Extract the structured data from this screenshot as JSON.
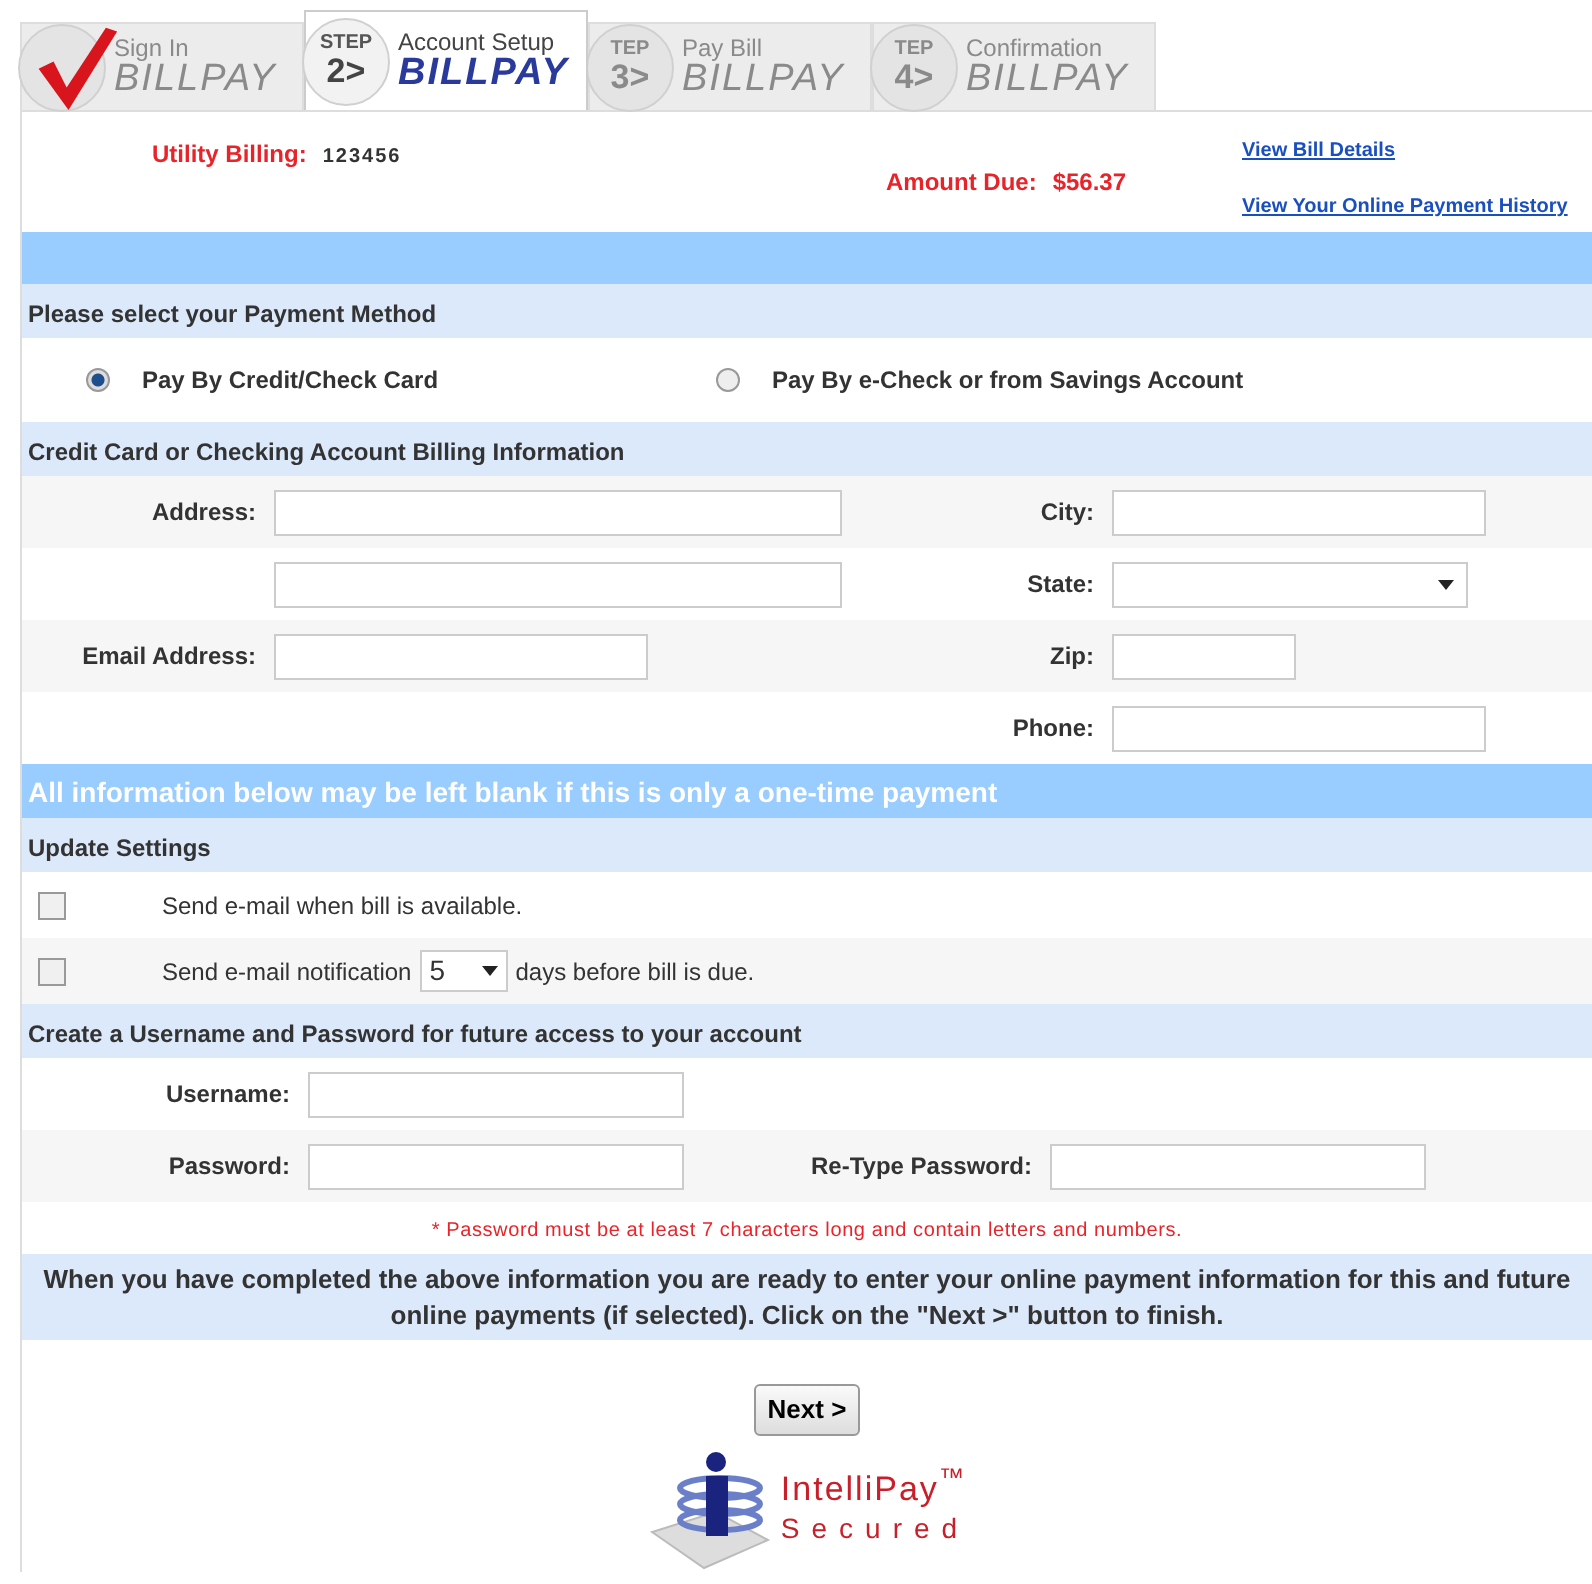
{
  "steps": [
    {
      "completed": true,
      "selected": false,
      "label": "Sign In",
      "brand": "BILLPAY"
    },
    {
      "completed": false,
      "selected": true,
      "step_word": "STEP",
      "number": "2>",
      "label": "Account Setup",
      "brand": "BILLPAY"
    },
    {
      "completed": false,
      "selected": false,
      "step_word": "TEP",
      "number": "3>",
      "label": "Pay Bill",
      "brand": "BILLPAY"
    },
    {
      "completed": false,
      "selected": false,
      "step_word": "TEP",
      "number": "4>",
      "label": "Confirmation",
      "brand": "BILLPAY"
    }
  ],
  "account": {
    "label": "Utility Billing:",
    "number": "123456"
  },
  "amount_due": {
    "label": "Amount Due:",
    "value": "$56.37"
  },
  "links": [
    "View Bill Details",
    "View Your Online Payment History"
  ],
  "payment_method": {
    "heading": "Please select your Payment Method",
    "options": [
      {
        "label": "Pay By Credit/Check Card",
        "selected": true
      },
      {
        "label": "Pay By e-Check or from Savings Account",
        "selected": false
      }
    ]
  },
  "billing": {
    "heading": "Credit Card or Checking Account Billing Information",
    "rows": [
      [
        {
          "kind": "text",
          "label": "Address:"
        },
        {
          "kind": "text",
          "label": "City:"
        }
      ],
      [
        {
          "kind": "text"
        },
        {
          "kind": "select",
          "label": "State:"
        }
      ],
      [
        {
          "kind": "text",
          "label": "Email Address:"
        },
        {
          "kind": "text",
          "label": "Zip:"
        }
      ],
      [
        {
          "kind": "blank"
        },
        {
          "kind": "text",
          "label": "Phone:"
        }
      ]
    ]
  },
  "notice": "All information below may be left blank if this is only a one-time payment",
  "update_settings": {
    "heading": "Update Settings",
    "items": [
      {
        "kind": "plain",
        "checked": false,
        "text": "Send e-mail when bill is available."
      },
      {
        "kind": "days",
        "checked": false,
        "text": "Send e-mail notification",
        "value": "5",
        "text_after": "days before bill is due."
      }
    ]
  },
  "credentials": {
    "heading": "Create a Username and Password for future access to your account",
    "rows": [
      [
        {
          "kind": "text",
          "label": "Username:"
        }
      ],
      [
        {
          "kind": "text",
          "label": "Password:"
        },
        {
          "kind": "text",
          "label": "Re-Type Password:"
        }
      ]
    ],
    "note": "* Password must be at least 7 characters long and contain letters and numbers."
  },
  "instructions": "When you have completed the above information you are ready to enter your online payment information for this and future online payments (if selected). Click on the \"Next >\" button to finish.",
  "next_button": "Next >",
  "logo": {
    "name": "IntelliPay$^{™}$",
    "tagline": "Secured"
  }
}
